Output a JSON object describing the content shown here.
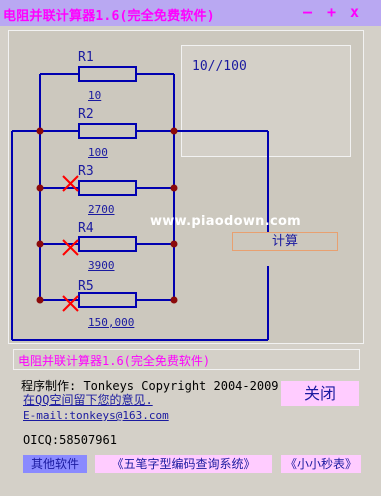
{
  "window": {
    "title": "电阻并联计算器1.6(完全免费软件)",
    "minimize_label": "—",
    "maximize_label": "+",
    "close_label": "x"
  },
  "circuit": {
    "result": "10//100",
    "resistors": [
      {
        "label": "R1",
        "value": "10",
        "disabled": false
      },
      {
        "label": "R2",
        "value": "100",
        "disabled": false
      },
      {
        "label": "R3",
        "value": "2700",
        "disabled": true
      },
      {
        "label": "R4",
        "value": "3900",
        "disabled": true
      },
      {
        "label": "R5",
        "value": "150,000",
        "disabled": true
      }
    ],
    "calculate_label": "计算",
    "watermark": "www.piaodown.com"
  },
  "info": {
    "display_text": "电阻并联计算器1.6(完全免费软件)",
    "author_line": "程序制作: Tonkeys Copyright 2004-2009",
    "feedback_link": "在QQ空间留下您的意见.",
    "email_link": "E-mail:tonkeys@163.com",
    "oicq": "OICQ:58507961",
    "close_button": "关闭"
  },
  "bottom_buttons": {
    "other_software": "其他软件",
    "wubi": "《五笔字型编码查询系统》",
    "xiaomiao": "《小小秒表》"
  },
  "colors": {
    "title_bar": "#b9a8f2",
    "accent_magenta": "#ff00ff",
    "link_blue": "#1a1aa0",
    "wire": "#0000b0",
    "node": "#8b0a0a",
    "disabled_x": "#ff0000",
    "close_bg": "#ffccff",
    "other_software_bg": "#8a8aff"
  }
}
